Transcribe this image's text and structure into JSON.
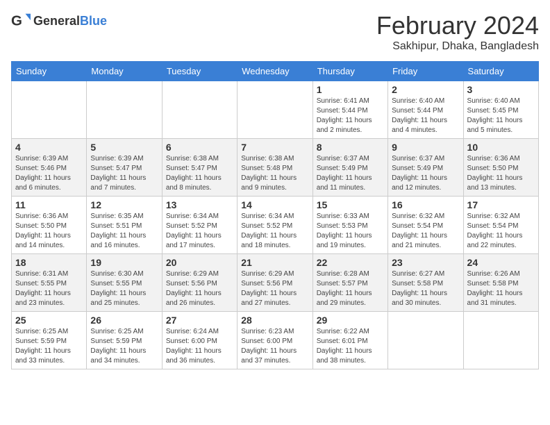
{
  "header": {
    "logo_general": "General",
    "logo_blue": "Blue",
    "title": "February 2024",
    "subtitle": "Sakhipur, Dhaka, Bangladesh"
  },
  "weekdays": [
    "Sunday",
    "Monday",
    "Tuesday",
    "Wednesday",
    "Thursday",
    "Friday",
    "Saturday"
  ],
  "weeks": [
    [
      {
        "day": "",
        "info": ""
      },
      {
        "day": "",
        "info": ""
      },
      {
        "day": "",
        "info": ""
      },
      {
        "day": "",
        "info": ""
      },
      {
        "day": "1",
        "info": "Sunrise: 6:41 AM\nSunset: 5:44 PM\nDaylight: 11 hours and 2 minutes."
      },
      {
        "day": "2",
        "info": "Sunrise: 6:40 AM\nSunset: 5:44 PM\nDaylight: 11 hours and 4 minutes."
      },
      {
        "day": "3",
        "info": "Sunrise: 6:40 AM\nSunset: 5:45 PM\nDaylight: 11 hours and 5 minutes."
      }
    ],
    [
      {
        "day": "4",
        "info": "Sunrise: 6:39 AM\nSunset: 5:46 PM\nDaylight: 11 hours and 6 minutes."
      },
      {
        "day": "5",
        "info": "Sunrise: 6:39 AM\nSunset: 5:47 PM\nDaylight: 11 hours and 7 minutes."
      },
      {
        "day": "6",
        "info": "Sunrise: 6:38 AM\nSunset: 5:47 PM\nDaylight: 11 hours and 8 minutes."
      },
      {
        "day": "7",
        "info": "Sunrise: 6:38 AM\nSunset: 5:48 PM\nDaylight: 11 hours and 9 minutes."
      },
      {
        "day": "8",
        "info": "Sunrise: 6:37 AM\nSunset: 5:49 PM\nDaylight: 11 hours and 11 minutes."
      },
      {
        "day": "9",
        "info": "Sunrise: 6:37 AM\nSunset: 5:49 PM\nDaylight: 11 hours and 12 minutes."
      },
      {
        "day": "10",
        "info": "Sunrise: 6:36 AM\nSunset: 5:50 PM\nDaylight: 11 hours and 13 minutes."
      }
    ],
    [
      {
        "day": "11",
        "info": "Sunrise: 6:36 AM\nSunset: 5:50 PM\nDaylight: 11 hours and 14 minutes."
      },
      {
        "day": "12",
        "info": "Sunrise: 6:35 AM\nSunset: 5:51 PM\nDaylight: 11 hours and 16 minutes."
      },
      {
        "day": "13",
        "info": "Sunrise: 6:34 AM\nSunset: 5:52 PM\nDaylight: 11 hours and 17 minutes."
      },
      {
        "day": "14",
        "info": "Sunrise: 6:34 AM\nSunset: 5:52 PM\nDaylight: 11 hours and 18 minutes."
      },
      {
        "day": "15",
        "info": "Sunrise: 6:33 AM\nSunset: 5:53 PM\nDaylight: 11 hours and 19 minutes."
      },
      {
        "day": "16",
        "info": "Sunrise: 6:32 AM\nSunset: 5:54 PM\nDaylight: 11 hours and 21 minutes."
      },
      {
        "day": "17",
        "info": "Sunrise: 6:32 AM\nSunset: 5:54 PM\nDaylight: 11 hours and 22 minutes."
      }
    ],
    [
      {
        "day": "18",
        "info": "Sunrise: 6:31 AM\nSunset: 5:55 PM\nDaylight: 11 hours and 23 minutes."
      },
      {
        "day": "19",
        "info": "Sunrise: 6:30 AM\nSunset: 5:55 PM\nDaylight: 11 hours and 25 minutes."
      },
      {
        "day": "20",
        "info": "Sunrise: 6:29 AM\nSunset: 5:56 PM\nDaylight: 11 hours and 26 minutes."
      },
      {
        "day": "21",
        "info": "Sunrise: 6:29 AM\nSunset: 5:56 PM\nDaylight: 11 hours and 27 minutes."
      },
      {
        "day": "22",
        "info": "Sunrise: 6:28 AM\nSunset: 5:57 PM\nDaylight: 11 hours and 29 minutes."
      },
      {
        "day": "23",
        "info": "Sunrise: 6:27 AM\nSunset: 5:58 PM\nDaylight: 11 hours and 30 minutes."
      },
      {
        "day": "24",
        "info": "Sunrise: 6:26 AM\nSunset: 5:58 PM\nDaylight: 11 hours and 31 minutes."
      }
    ],
    [
      {
        "day": "25",
        "info": "Sunrise: 6:25 AM\nSunset: 5:59 PM\nDaylight: 11 hours and 33 minutes."
      },
      {
        "day": "26",
        "info": "Sunrise: 6:25 AM\nSunset: 5:59 PM\nDaylight: 11 hours and 34 minutes."
      },
      {
        "day": "27",
        "info": "Sunrise: 6:24 AM\nSunset: 6:00 PM\nDaylight: 11 hours and 36 minutes."
      },
      {
        "day": "28",
        "info": "Sunrise: 6:23 AM\nSunset: 6:00 PM\nDaylight: 11 hours and 37 minutes."
      },
      {
        "day": "29",
        "info": "Sunrise: 6:22 AM\nSunset: 6:01 PM\nDaylight: 11 hours and 38 minutes."
      },
      {
        "day": "",
        "info": ""
      },
      {
        "day": "",
        "info": ""
      }
    ]
  ]
}
